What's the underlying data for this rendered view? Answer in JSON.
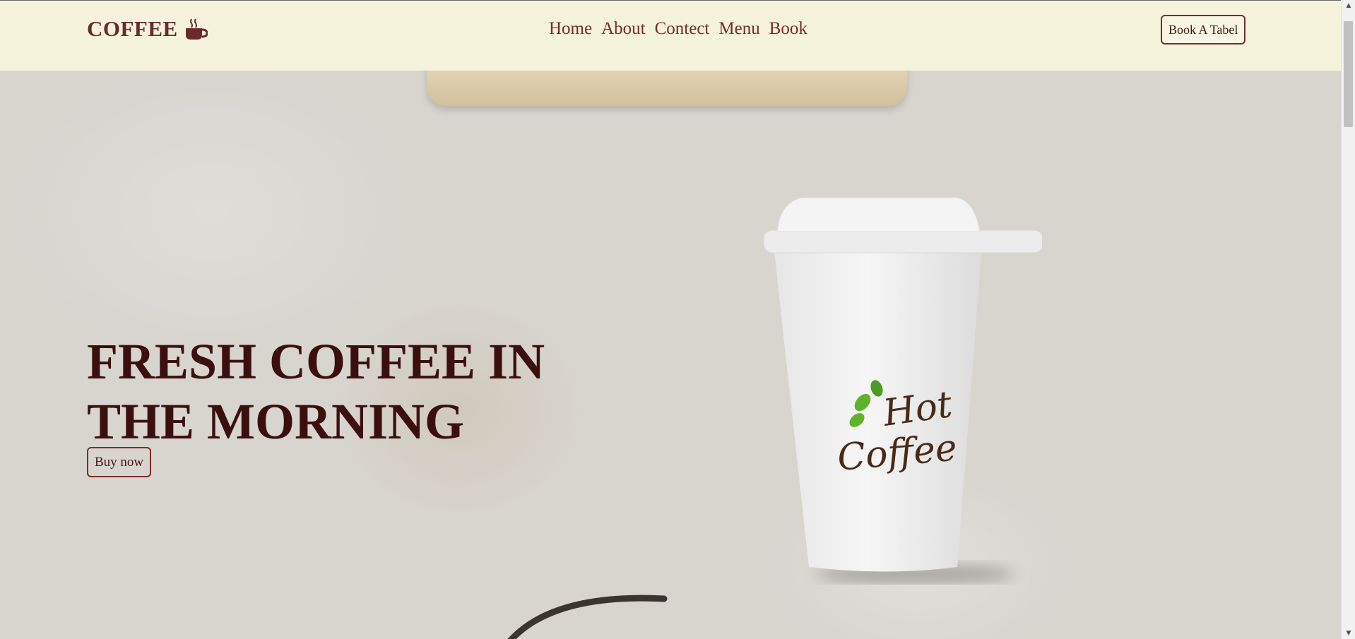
{
  "header": {
    "logo_text": "COFFEE",
    "logo_icon": "coffee-cup-icon",
    "nav": [
      "Home",
      "About",
      "Contect",
      "Menu",
      "Book"
    ],
    "cta_label": "Book A Tabel"
  },
  "hero": {
    "headline": "FRESH COFFEE IN THE MORNING",
    "button_label": "Buy now",
    "cup_logo": "Hot Coffee"
  },
  "colors": {
    "header_bg": "#f5f3dc",
    "brand": "#7a2b2b",
    "headline": "#3c0f0f",
    "hero_bg": "#d8d5cf",
    "cup_logo_text": "#4a2a16",
    "cup_logo_beans": "#5fb32a"
  }
}
